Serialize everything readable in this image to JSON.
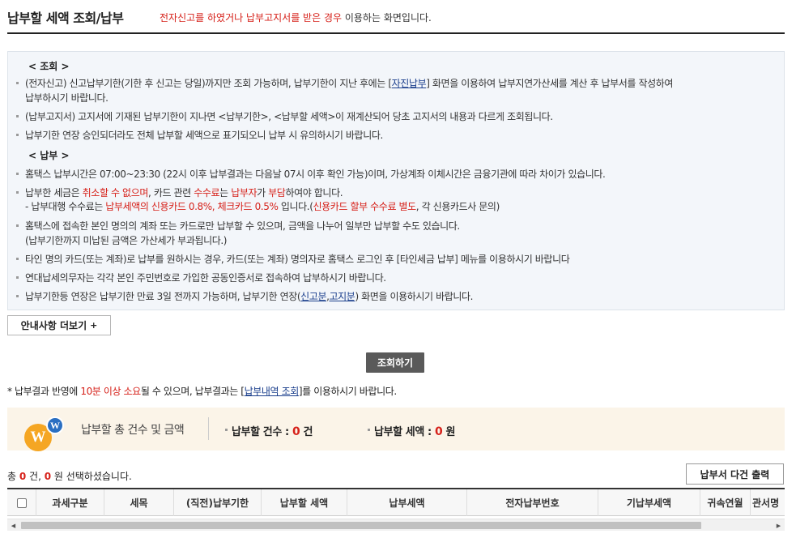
{
  "header": {
    "title": "납부할 세액 조회/납부",
    "subtitle_red": "전자신고를 하였거나 납부고지서를 받은 경우",
    "subtitle_rest": " 이용하는 화면입니다."
  },
  "info": {
    "section_inquiry": "< 조회 >",
    "inquiry_1a": "(전자신고) 신고납부기한(기한 후 신고는 당일)까지만 조회 가능하며, 납부기한이 지난 후에는 [",
    "inquiry_1_link": "자진납부",
    "inquiry_1b": "] 화면을 이용하여 납부지연가산세를 계산 후 납부서를 작성하여",
    "inquiry_1c": "납부하시기 바랍니다.",
    "inquiry_2": "(납부고지서) 고지서에 기재된 납부기한이 지나면 <납부기한>, <납부할 세액>이 재계산되어 당초 고지서의 내용과 다르게 조회됩니다.",
    "inquiry_3": "납부기한 연장 승인되더라도 전체 납부할 세액으로 표기되오니 납부 시 유의하시기 바랍니다.",
    "section_payment": "< 납부 >",
    "pay_1": "홈택스 납부시간은 07:00~23:30 (22시 이후 납부결과는 다음날 07시 이후 확인 가능)이며, 가상계좌 이체시간은 금융기관에 따라 차이가 있습니다.",
    "pay_2a": "납부한 세금은 ",
    "pay_2_red1": "취소할 수 없으며",
    "pay_2b": ", 카드 관련 ",
    "pay_2_red2": "수수료",
    "pay_2c": "는 ",
    "pay_2_red3": "납부자",
    "pay_2d": "가 ",
    "pay_2_red4": "부담",
    "pay_2e": "하여야 합니다.",
    "pay_3a": "- 납부대행 수수료는 ",
    "pay_3_red1": "납부세액의 신용카드 0.8%, 체크카드 0.5%",
    "pay_3b": " 입니다.(",
    "pay_3_red2": "신용카드 할부 수수료 별도",
    "pay_3c": ", 각 신용카드사 문의)",
    "pay_4": "홈택스에 접속한 본인 명의의 계좌 또는 카드로만 납부할 수 있으며, 금액을 나누어 일부만 납부할 수도 있습니다.",
    "pay_4b": "(납부기한까지 미납된 금액은 가산세가 부과됩니다.)",
    "pay_5": "타인 명의 카드(또는 계좌)로 납부를 원하시는 경우, 카드(또는 계좌) 명의자로 홈택스 로그인 후 [타인세금 납부] 메뉴를 이용하시기 바랍니다",
    "pay_6": "연대납세의무자는 각각 본인 주민번호로 가입한 공동인증서로 접속하여 납부하시기 바랍니다.",
    "pay_7a": "납부기한등 연장은 납부기한 만료 3일 전까지 가능하며, 납부기한 연장(",
    "pay_7_link1": "신고분",
    "pay_7_sep": ",",
    "pay_7_link2": "고지분",
    "pay_7b": ") 화면을 이용하시기 바랍니다."
  },
  "buttons": {
    "more": "안내사항 더보기",
    "more_icon": "+",
    "query": "조회하기",
    "print": "납부서 다건 출력"
  },
  "note": {
    "a": "* 납부결과 반영에 ",
    "red": "10분 이상 소요",
    "b": "될 수 있으며, 납부결과는 [",
    "link": "납부내역 조회",
    "c": "]를 이용하시기 바랍니다."
  },
  "summary": {
    "badge_big": "W",
    "badge_small": "W",
    "label": "납부할 총 건수 및 금액",
    "count_label": "납부할 건수 : ",
    "count_value": "0",
    "count_unit": " 건",
    "amount_label": "납부할 세액 : ",
    "amount_value": "0",
    "amount_unit": " 원"
  },
  "selection": {
    "prefix": "총 ",
    "count": "0",
    "mid": " 건, ",
    "amount": "0",
    "suffix": " 원 선택하셨습니다."
  },
  "table": {
    "columns": [
      "과세구분",
      "세목",
      "(직전)납부기한",
      "납부할 세액",
      "납부세액",
      "전자납부번호",
      "기납부세액",
      "귀속연월",
      "관서명"
    ]
  },
  "colors": {
    "accent_red": "#d6211a",
    "link_blue": "#1a3e8c",
    "query_button": "#5a5a5a",
    "summary_bg": "#fbf4e8",
    "info_bg": "#f3f6fa"
  }
}
